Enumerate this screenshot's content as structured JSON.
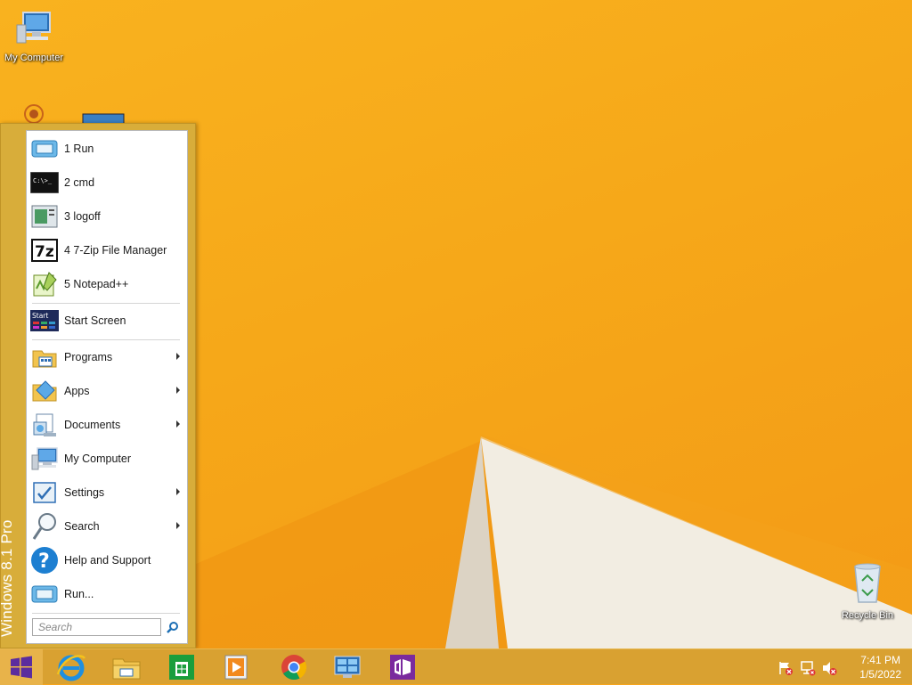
{
  "desktop": {
    "icons": [
      {
        "label": "My Computer",
        "icon": "computer-icon"
      },
      {
        "label": "Recycle Bin",
        "icon": "recycle-bin-icon"
      }
    ]
  },
  "start_menu": {
    "side_label": "Windows 8.1 Pro",
    "recent": [
      {
        "label": "1 Run",
        "icon": "run-icon"
      },
      {
        "label": "2 cmd",
        "icon": "cmd-icon"
      },
      {
        "label": "3 logoff",
        "icon": "logoff-icon"
      },
      {
        "label": "4 7-Zip File Manager",
        "icon": "7zip-icon"
      },
      {
        "label": "5 Notepad++",
        "icon": "notepadpp-icon"
      }
    ],
    "start_screen": {
      "label": "Start Screen",
      "icon_text": "Start"
    },
    "main": [
      {
        "label": "Programs",
        "icon": "programs-icon",
        "submenu": true
      },
      {
        "label": "Apps",
        "icon": "apps-icon",
        "submenu": true
      },
      {
        "label": "Documents",
        "icon": "documents-icon",
        "submenu": true
      },
      {
        "label": "My Computer",
        "icon": "computer-icon",
        "submenu": false
      },
      {
        "label": "Settings",
        "icon": "settings-icon",
        "submenu": true
      },
      {
        "label": "Search",
        "icon": "search-icon",
        "submenu": true
      },
      {
        "label": "Help and Support",
        "icon": "help-icon",
        "submenu": false
      },
      {
        "label": "Run...",
        "icon": "run-icon",
        "submenu": false
      }
    ],
    "search": {
      "placeholder": "Search"
    }
  },
  "taskbar": {
    "apps": [
      {
        "name": "internet-explorer",
        "icon": "internet-explorer-icon"
      },
      {
        "name": "file-explorer",
        "icon": "folder-icon"
      },
      {
        "name": "store",
        "icon": "store-icon"
      },
      {
        "name": "media-player",
        "icon": "media-player-icon"
      },
      {
        "name": "chrome",
        "icon": "chrome-icon"
      },
      {
        "name": "control-panel",
        "icon": "control-panel-icon"
      },
      {
        "name": "visual-studio",
        "icon": "visual-studio-icon"
      }
    ],
    "clock": {
      "time": "7:41 PM",
      "date": "1/5/2022"
    }
  },
  "colors": {
    "accent": "#d9a131",
    "desktop": "#f7a51c"
  }
}
